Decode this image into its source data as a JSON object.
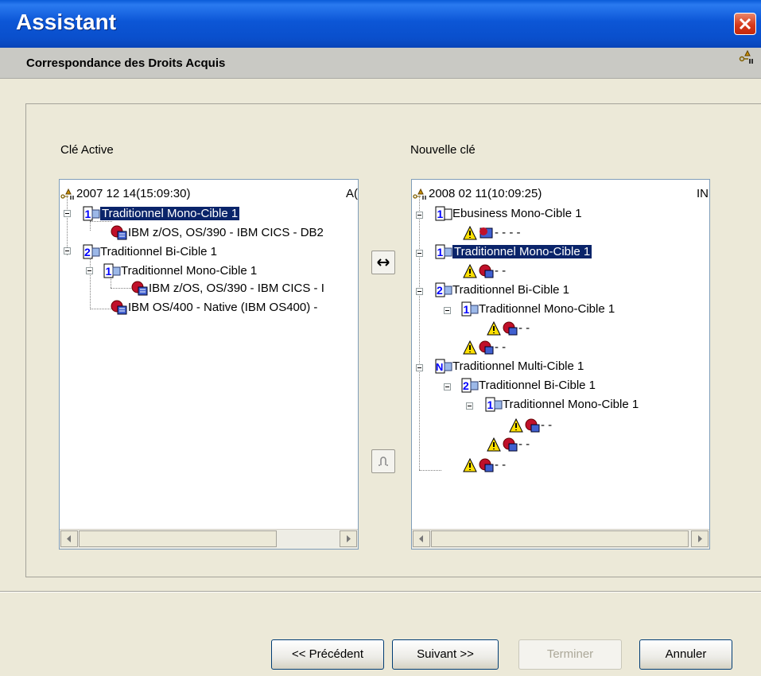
{
  "window": {
    "title": "Assistant",
    "header": "Correspondance des Droits Acquis"
  },
  "left": {
    "label": "Clé Active",
    "root": "2007 12 14(15:09:30)",
    "root_suffix": "A(",
    "items": [
      {
        "text": "Traditionnel Mono-Cible 1",
        "icon": "mono-cible-icon",
        "selected": true
      },
      {
        "text": "IBM z/OS, OS/390 - IBM CICS - DB2",
        "icon": "ibm-target-icon"
      },
      {
        "text": "Traditionnel Bi-Cible 1",
        "icon": "bi-cible-icon"
      },
      {
        "text": "Traditionnel Mono-Cible 1",
        "icon": "mono-cible-icon"
      },
      {
        "text": "IBM z/OS, OS/390 - IBM CICS - I",
        "icon": "ibm-target-icon"
      },
      {
        "text": "IBM OS/400 - Native (IBM OS400) -",
        "icon": "ibm-target-icon"
      }
    ]
  },
  "right": {
    "label": "Nouvelle clé",
    "root": "2008 02 11(10:09:25)",
    "root_suffix": "IN",
    "items": [
      {
        "text": "Ebusiness Mono-Cible 1",
        "icon": "ebusiness-icon"
      },
      {
        "text": "- - - -",
        "icon": "warning-icon"
      },
      {
        "text": "Traditionnel Mono-Cible 1",
        "icon": "mono-cible-icon",
        "selected": true
      },
      {
        "text": "- -",
        "icon": "warning-icon"
      },
      {
        "text": "Traditionnel Bi-Cible 1",
        "icon": "bi-cible-icon"
      },
      {
        "text": "Traditionnel Mono-Cible 1",
        "icon": "mono-cible-icon"
      },
      {
        "text": "- -",
        "icon": "warning-icon"
      },
      {
        "text": "- -",
        "icon": "warning-icon"
      },
      {
        "text": "Traditionnel Multi-Cible 1",
        "icon": "multi-cible-icon"
      },
      {
        "text": "Traditionnel Bi-Cible 1",
        "icon": "bi-cible-icon"
      },
      {
        "text": "Traditionnel Mono-Cible 1",
        "icon": "mono-cible-icon"
      },
      {
        "text": "- -",
        "icon": "warning-icon"
      },
      {
        "text": "- -",
        "icon": "warning-icon"
      },
      {
        "text": "- -",
        "icon": "warning-icon"
      }
    ]
  },
  "center": {
    "map_icon": "swap-arrows-icon",
    "unmap_icon": "unlink-icon"
  },
  "buttons": {
    "previous": "<< Précédent",
    "next": "Suivant >>",
    "finish": "Terminer",
    "cancel": "Annuler"
  },
  "colors": {
    "title_bar": "#0a5bd8",
    "selection": "#0a246a",
    "window_bg": "#ece9d8"
  }
}
